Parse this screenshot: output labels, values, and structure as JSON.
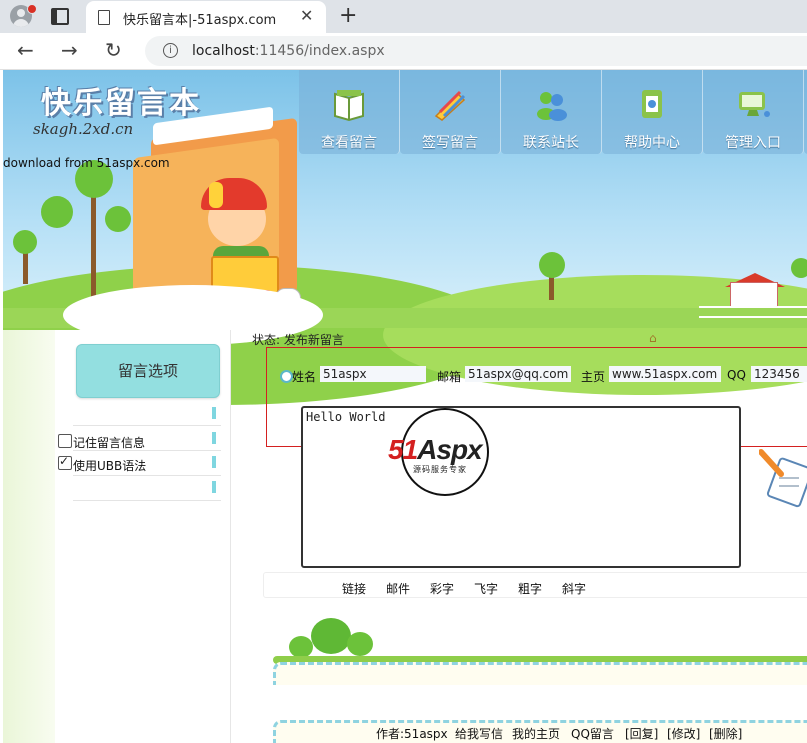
{
  "browser": {
    "tab_title": "快乐留言本|-51aspx.com",
    "url_host": "localhost",
    "url_rest": ":11456/index.aspx",
    "icons": [
      "profile-icon",
      "tab-actions-icon",
      "page-icon",
      "close-icon",
      "new-tab-icon",
      "back-icon",
      "forward-icon",
      "reload-icon",
      "info-icon"
    ]
  },
  "banner": {
    "logo_title": "快乐留言本",
    "logo_subtitle": "skagh.2xd.cn",
    "download_text": "download from 51aspx.com"
  },
  "nav": [
    {
      "label": "查看留言",
      "icon": "book-icon"
    },
    {
      "label": "签写留言",
      "icon": "pencil-icon"
    },
    {
      "label": "联系站长",
      "icon": "people-icon"
    },
    {
      "label": "帮助中心",
      "icon": "help-icon"
    },
    {
      "label": "管理入口",
      "icon": "monitor-icon"
    }
  ],
  "sidebar": {
    "options_button": "留言选项",
    "remember_label": "记住留言信息",
    "remember_checked": false,
    "ubb_label": "使用UBB语法",
    "ubb_checked": true
  },
  "form": {
    "status": "状态: 发布新留言",
    "name_label": "姓名",
    "name_value": "51aspx",
    "email_label": "邮箱",
    "email_value": "51aspx@qq.com",
    "homepage_label": "主页",
    "homepage_value": "www.51aspx.com",
    "qq_label": "QQ",
    "qq_value": "123456",
    "message": "Hello World",
    "watermark_red": "51",
    "watermark_black": "Aspx",
    "watermark_sub": "源码服务专家"
  },
  "toolbar": [
    "链接",
    "邮件",
    "彩字",
    "飞字",
    "粗字",
    "斜字"
  ],
  "footer_links": [
    "作者:51aspx",
    "给我写信",
    "我的主页",
    "QQ留言",
    "[回复]",
    "[修改]",
    "[删除]"
  ],
  "colors": {
    "sky": "#7cc2e8",
    "grass": "#8fd14a",
    "options_button": "#93dfe0",
    "highlight_box": "#d42020",
    "accent_cyan": "#8fd3e0"
  }
}
